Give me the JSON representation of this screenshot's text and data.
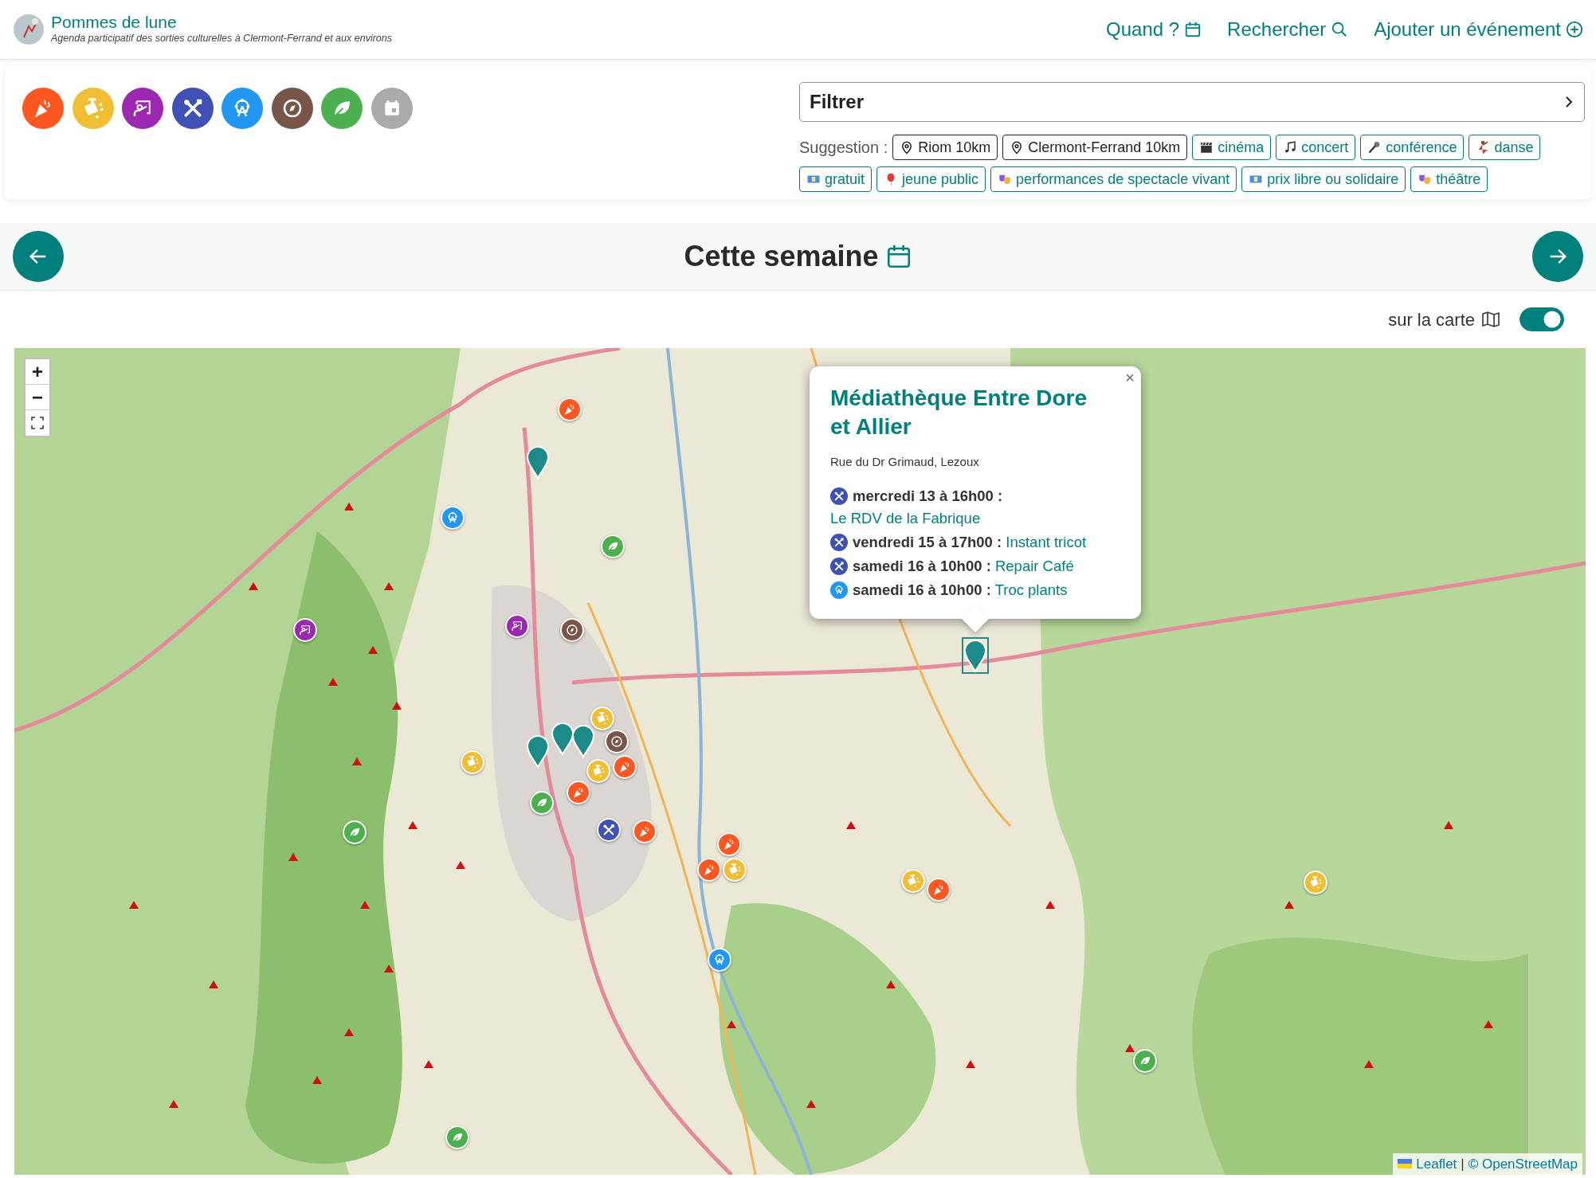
{
  "site": {
    "title": "Pommes de lune",
    "tagline": "Agenda participatif des sorties culturelles à Clermont-Ferrand et aux environs"
  },
  "nav": [
    {
      "kind": "calendar",
      "label": "Quand ?"
    },
    {
      "kind": "search",
      "label": "Rechercher"
    },
    {
      "kind": "add",
      "label": "Ajouter un événement"
    }
  ],
  "categories": [
    {
      "kind": "party",
      "color": "#ff5722"
    },
    {
      "kind": "paint",
      "color": "#f0be32"
    },
    {
      "kind": "art",
      "color": "#9c27b0"
    },
    {
      "kind": "tools",
      "color": "#3f51b5"
    },
    {
      "kind": "wheel",
      "color": "#2196f3"
    },
    {
      "kind": "compass",
      "color": "#795548"
    },
    {
      "kind": "leaf",
      "color": "#4caf50"
    },
    {
      "kind": "calendar",
      "color": "#aaaaaa"
    }
  ],
  "filter": {
    "label": "Filtrer"
  },
  "suggestion_label": "Suggestion :",
  "suggestions": [
    {
      "kind": "place",
      "label": "Riom 10km"
    },
    {
      "kind": "place",
      "label": "Clermont-Ferrand 10km"
    },
    {
      "kind": "tag",
      "label": "cinéma"
    },
    {
      "kind": "tag",
      "label": "concert"
    },
    {
      "kind": "tag",
      "label": "conférence"
    },
    {
      "kind": "tag",
      "label": "danse"
    },
    {
      "kind": "tag",
      "label": "gratuit"
    },
    {
      "kind": "tag",
      "label": "jeune public"
    },
    {
      "kind": "tag",
      "label": "performances de spectacle vivant"
    },
    {
      "kind": "tag",
      "label": "prix libre ou solidaire"
    },
    {
      "kind": "tag",
      "label": "théâtre"
    }
  ],
  "week": {
    "title": "Cette semaine"
  },
  "map_toggle": {
    "label": "sur la carte",
    "on": true
  },
  "map": {
    "zoom_in": "+",
    "zoom_out": "−",
    "markers": [
      {
        "kind": "party"
      },
      {
        "kind": "wheel"
      },
      {
        "kind": "leaf"
      },
      {
        "kind": "art"
      },
      {
        "kind": "art"
      },
      {
        "kind": "compass"
      },
      {
        "kind": "paint"
      },
      {
        "kind": "compass"
      },
      {
        "kind": "paint"
      },
      {
        "kind": "party"
      },
      {
        "kind": "paint"
      },
      {
        "kind": "party"
      },
      {
        "kind": "leaf"
      },
      {
        "kind": "leaf"
      },
      {
        "kind": "tools"
      },
      {
        "kind": "party"
      },
      {
        "kind": "party"
      },
      {
        "kind": "paint"
      },
      {
        "kind": "party"
      },
      {
        "kind": "paint"
      },
      {
        "kind": "party"
      },
      {
        "kind": "paint"
      },
      {
        "kind": "wheel"
      },
      {
        "kind": "leaf"
      },
      {
        "kind": "leaf"
      }
    ],
    "pins": [
      {
        "selected": false
      },
      {
        "selected": false
      },
      {
        "selected": false
      },
      {
        "selected": false
      },
      {
        "selected": true
      }
    ],
    "popup": {
      "close": "×",
      "title": "Médiathèque Entre Dore et Allier",
      "address": "Rue du Dr Grimaud, Lezoux",
      "events": [
        {
          "kind": "tools",
          "when": "mercredi 13 à 16h00 :",
          "title": "Le RDV de la Fabrique"
        },
        {
          "kind": "tools",
          "when": "vendredi 15 à 17h00 :",
          "title": "Instant tricot"
        },
        {
          "kind": "tools",
          "when": "samedi 16 à 10h00 :",
          "title": "Repair Café"
        },
        {
          "kind": "wheel",
          "when": "samedi 16 à 10h00 :",
          "title": "Troc plants"
        }
      ]
    },
    "attribution": {
      "leaflet": "Leaflet",
      "separator": "|",
      "osm": "© OpenStreetMap"
    }
  }
}
